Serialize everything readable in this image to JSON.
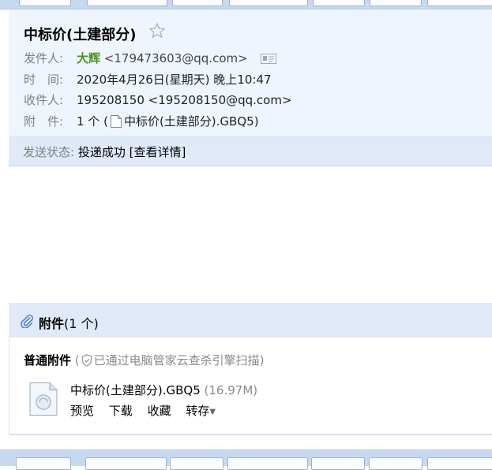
{
  "mail": {
    "subject": "中标价(土建部分)",
    "from_label": "发件人:",
    "from_name": "大辉",
    "from_email": "<179473603@qq.com>",
    "time_label": "时　间:",
    "time_value": "2020年4月26日(星期天) 晚上10:47",
    "to_label": "收件人:",
    "to_value": "195208150 <195208150@qq.com>",
    "attach_label": "附　件:",
    "attach_count_prefix": "1 个 (",
    "attach_inline_name": "中标价(土建部分).GBQ5",
    "attach_count_suffix": ")"
  },
  "status": {
    "label": "发送状态:",
    "value": "投递成功",
    "detail": "[查看详情]"
  },
  "attachments": {
    "title": "附件",
    "count": "(1 个)",
    "type_label": "普通附件",
    "scan_prefix": "(",
    "scan_text": "已通过电脑管家云查杀引擎扫描",
    "scan_suffix": ")",
    "file": {
      "name": "中标价(土建部分).GBQ5",
      "size": "(16.97M)",
      "actions": [
        "预览",
        "下载",
        "收藏",
        "转存"
      ]
    }
  },
  "icons": {
    "star": "star-icon",
    "vcard": "vcard-icon",
    "file": "file-icon",
    "paperclip": "paperclip-icon",
    "shield": "shield-icon"
  },
  "colors": {
    "header_bg": "#eff5fd",
    "band_bg": "#dfe9f8",
    "sender_name": "#4a9520",
    "muted": "#808080",
    "toolbar": "#c7d9f0"
  }
}
